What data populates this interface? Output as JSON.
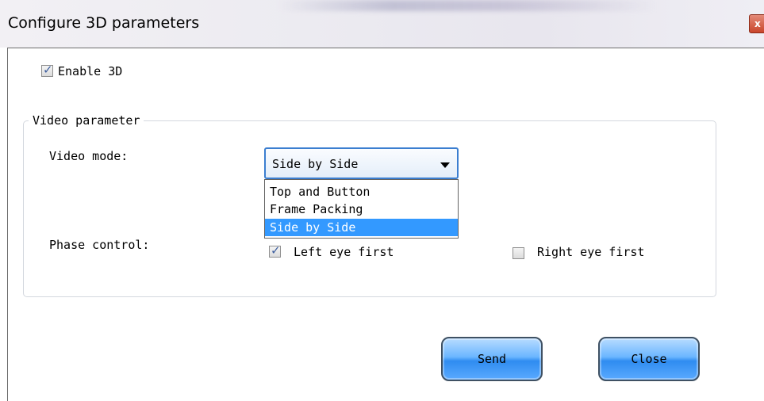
{
  "window": {
    "title": "Configure 3D parameters",
    "close_glyph": "x"
  },
  "enable_3d": {
    "label": "Enable 3D",
    "checked": true
  },
  "video_parameter": {
    "group_title": "Video parameter",
    "video_mode": {
      "label": "Video mode:",
      "selected": "Side by Side",
      "options": [
        "Top and Button",
        "Frame Packing",
        "Side by Side"
      ]
    },
    "phase_control": {
      "label": "Phase control:",
      "left_eye": {
        "label": "Left eye first",
        "checked": true
      },
      "right_eye": {
        "label": "Right eye first",
        "checked": false
      }
    }
  },
  "buttons": {
    "send": "Send",
    "close": "Close"
  },
  "colors": {
    "selection": "#3399ff",
    "button_blue": "#2f8cf0",
    "focus_border": "#3b7ed0"
  },
  "check_glyph": "✓"
}
